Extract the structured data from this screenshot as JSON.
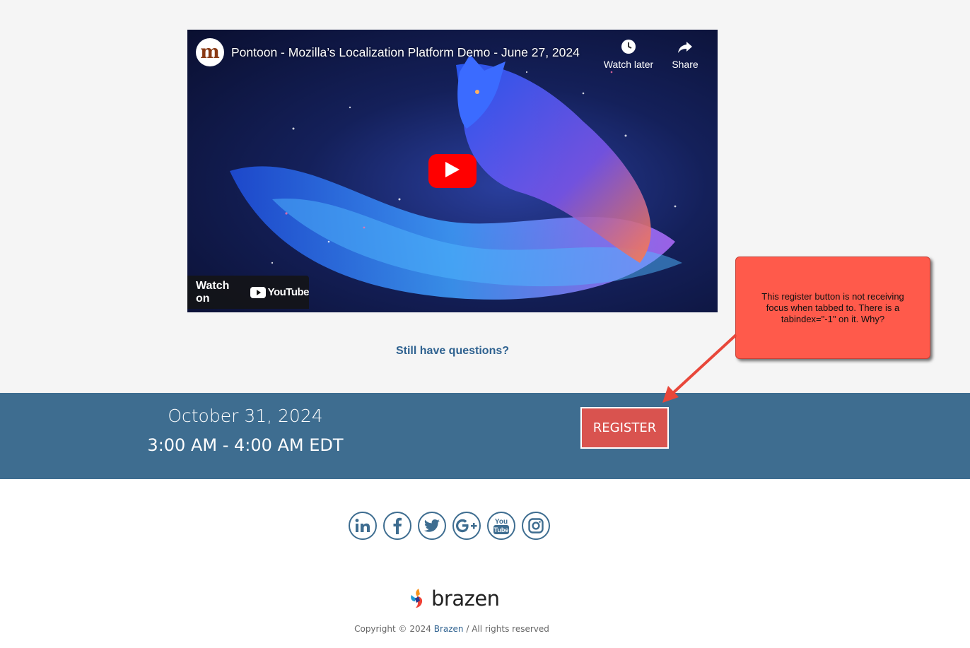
{
  "video": {
    "channel_initial": "m",
    "title": "Pontoon - Mozilla’s Localization Platform Demo - June 27, 2024",
    "watch_later_label": "Watch later",
    "share_label": "Share",
    "watch_on_label": "Watch on",
    "youtube_wordmark": "YouTube",
    "play_icon": "play-icon",
    "colors": {
      "play": "#ff0000"
    }
  },
  "questions_link": "Still have questions?",
  "event": {
    "date": "October 31, 2024",
    "time": "3:00 AM - 4:00 AM EDT",
    "register_label": "REGISTER",
    "colors": {
      "band": "#3e6d90",
      "register": "#d9534f"
    }
  },
  "annotation": {
    "text": "This register button is not receiving focus when tabbed to. There is a tabindex=\"-1\" on it. Why?",
    "color": "#ff5a4b"
  },
  "social": [
    {
      "name": "linkedin-icon"
    },
    {
      "name": "facebook-icon"
    },
    {
      "name": "twitter-icon"
    },
    {
      "name": "google-plus-icon"
    },
    {
      "name": "youtube-icon"
    },
    {
      "name": "instagram-icon"
    }
  ],
  "footer": {
    "brand": "brazen",
    "copyright_prefix": "Copyright © 2024 ",
    "copyright_link": "Brazen",
    "copyright_suffix": " / All rights reserved"
  }
}
